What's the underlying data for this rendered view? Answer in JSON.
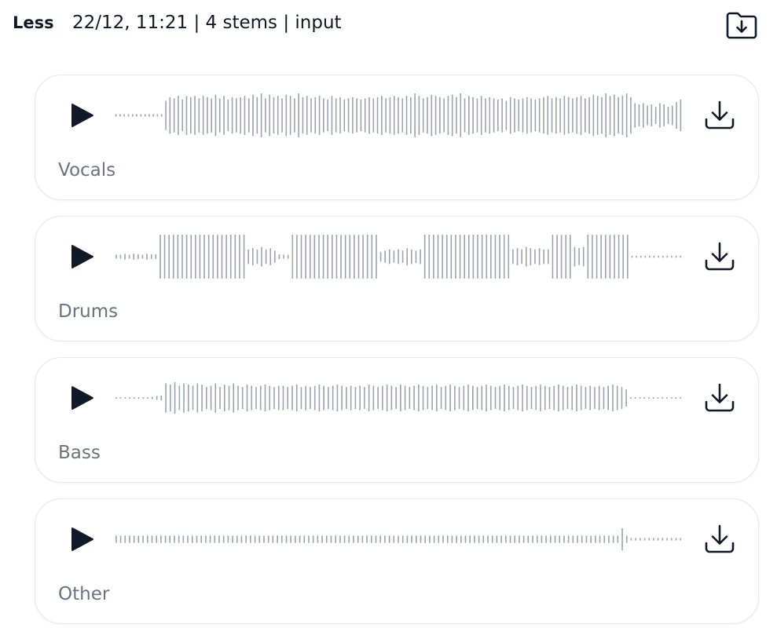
{
  "header": {
    "toggle_label": "Less",
    "meta": "22/12, 11:21 | 4 stems | input",
    "folder_icon": "folder-download-icon"
  },
  "colors": {
    "text": "#111827",
    "label": "#6b7280",
    "waveform": "#9ca3af",
    "card_border": "#e5e7eb"
  },
  "stems": [
    {
      "label": "Vocals",
      "play_icon": "play-icon",
      "download_icon": "download-icon",
      "waveform_levels": [
        0.05,
        0.05,
        0.05,
        0.05,
        0.05,
        0.05,
        0.05,
        0.05,
        0.05,
        0.05,
        0.05,
        0.05,
        0.6,
        0.75,
        0.7,
        0.8,
        0.65,
        0.8,
        0.75,
        0.8,
        0.7,
        0.8,
        0.75,
        0.7,
        0.85,
        0.7,
        0.8,
        0.65,
        0.75,
        0.7,
        0.75,
        0.8,
        0.7,
        0.85,
        0.75,
        0.9,
        0.7,
        0.85,
        0.75,
        0.8,
        0.7,
        0.85,
        0.8,
        0.7,
        0.9,
        0.75,
        0.8,
        0.7,
        0.75,
        0.8,
        0.7,
        0.65,
        0.8,
        0.7,
        0.75,
        0.65,
        0.7,
        0.75,
        0.7,
        0.65,
        0.7,
        0.75,
        0.7,
        0.75,
        0.8,
        0.7,
        0.75,
        0.8,
        0.75,
        0.7,
        0.8,
        0.75,
        0.9,
        0.8,
        0.7,
        0.75,
        0.85,
        0.8,
        0.75,
        0.7,
        0.8,
        0.85,
        0.75,
        0.9,
        0.7,
        0.8,
        0.75,
        0.7,
        0.8,
        0.7,
        0.75,
        0.7,
        0.65,
        0.7,
        0.6,
        0.75,
        0.7,
        0.65,
        0.7,
        0.75,
        0.7,
        0.65,
        0.7,
        0.75,
        0.8,
        0.7,
        0.75,
        0.7,
        0.8,
        0.75,
        0.7,
        0.75,
        0.8,
        0.7,
        0.75,
        0.85,
        0.8,
        0.75,
        0.9,
        0.8,
        0.85,
        0.75,
        0.8,
        0.9,
        0.75,
        0.5,
        0.45,
        0.5,
        0.4,
        0.45,
        0.35,
        0.5,
        0.45,
        0.35,
        0.4,
        0.55,
        0.65
      ]
    },
    {
      "label": "Drums",
      "play_icon": "play-icon",
      "download_icon": "download-icon",
      "waveform_levels": [
        0.08,
        0.08,
        0.12,
        0.08,
        0.12,
        0.1,
        0.08,
        0.12,
        0.1,
        0.1,
        0.9,
        0.9,
        0.9,
        0.9,
        0.9,
        0.9,
        0.9,
        0.9,
        0.9,
        0.9,
        0.9,
        0.9,
        0.9,
        0.9,
        0.9,
        0.9,
        0.9,
        0.9,
        0.9,
        0.9,
        0.3,
        0.35,
        0.3,
        0.4,
        0.3,
        0.35,
        0.25,
        0.1,
        0.08,
        0.08,
        0.9,
        0.9,
        0.9,
        0.9,
        0.9,
        0.9,
        0.9,
        0.9,
        0.9,
        0.9,
        0.9,
        0.9,
        0.9,
        0.9,
        0.9,
        0.9,
        0.9,
        0.9,
        0.9,
        0.9,
        0.2,
        0.25,
        0.3,
        0.25,
        0.3,
        0.25,
        0.35,
        0.3,
        0.25,
        0.3,
        0.9,
        0.9,
        0.9,
        0.9,
        0.9,
        0.9,
        0.9,
        0.9,
        0.9,
        0.9,
        0.9,
        0.9,
        0.9,
        0.9,
        0.9,
        0.9,
        0.9,
        0.9,
        0.9,
        0.9,
        0.3,
        0.35,
        0.3,
        0.4,
        0.35,
        0.3,
        0.35,
        0.3,
        0.3,
        0.9,
        0.9,
        0.9,
        0.9,
        0.9,
        0.4,
        0.35,
        0.4,
        0.9,
        0.9,
        0.9,
        0.9,
        0.9,
        0.9,
        0.9,
        0.9,
        0.9,
        0.9,
        0.04,
        0.04,
        0.04,
        0.04,
        0.04,
        0.04,
        0.04,
        0.04,
        0.04,
        0.04,
        0.04,
        0.04
      ]
    },
    {
      "label": "Bass",
      "play_icon": "play-icon",
      "download_icon": "download-icon",
      "waveform_levels": [
        0.03,
        0.03,
        0.03,
        0.03,
        0.03,
        0.03,
        0.03,
        0.03,
        0.05,
        0.08,
        0.1,
        0.6,
        0.55,
        0.65,
        0.5,
        0.6,
        0.55,
        0.5,
        0.6,
        0.55,
        0.45,
        0.5,
        0.6,
        0.45,
        0.55,
        0.5,
        0.6,
        0.5,
        0.45,
        0.55,
        0.5,
        0.45,
        0.5,
        0.55,
        0.5,
        0.45,
        0.5,
        0.5,
        0.45,
        0.5,
        0.55,
        0.45,
        0.5,
        0.45,
        0.5,
        0.55,
        0.5,
        0.45,
        0.5,
        0.55,
        0.5,
        0.45,
        0.5,
        0.45,
        0.5,
        0.45,
        0.55,
        0.5,
        0.45,
        0.5,
        0.55,
        0.5,
        0.45,
        0.55,
        0.5,
        0.45,
        0.5,
        0.55,
        0.5,
        0.45,
        0.5,
        0.55,
        0.45,
        0.5,
        0.55,
        0.5,
        0.45,
        0.5,
        0.55,
        0.5,
        0.45,
        0.5,
        0.55,
        0.5,
        0.45,
        0.5,
        0.55,
        0.5,
        0.45,
        0.5,
        0.55,
        0.5,
        0.45,
        0.5,
        0.55,
        0.5,
        0.45,
        0.5,
        0.55,
        0.5,
        0.45,
        0.5,
        0.55,
        0.5,
        0.45,
        0.5,
        0.45,
        0.5,
        0.45,
        0.5,
        0.55,
        0.5,
        0.45,
        0.35,
        0.03,
        0.03,
        0.03,
        0.03,
        0.03,
        0.03,
        0.03,
        0.03,
        0.03,
        0.03,
        0.03,
        0.03
      ]
    },
    {
      "label": "Other",
      "play_icon": "play-icon",
      "download_icon": "download-icon",
      "waveform_levels": [
        0.15,
        0.15,
        0.15,
        0.15,
        0.15,
        0.15,
        0.15,
        0.15,
        0.15,
        0.15,
        0.15,
        0.15,
        0.15,
        0.15,
        0.15,
        0.15,
        0.15,
        0.15,
        0.15,
        0.15,
        0.15,
        0.15,
        0.15,
        0.15,
        0.15,
        0.15,
        0.15,
        0.15,
        0.15,
        0.15,
        0.15,
        0.15,
        0.15,
        0.15,
        0.15,
        0.15,
        0.15,
        0.15,
        0.15,
        0.15,
        0.15,
        0.15,
        0.15,
        0.15,
        0.15,
        0.15,
        0.15,
        0.15,
        0.15,
        0.15,
        0.15,
        0.15,
        0.15,
        0.15,
        0.15,
        0.15,
        0.15,
        0.15,
        0.15,
        0.15,
        0.15,
        0.15,
        0.15,
        0.15,
        0.15,
        0.15,
        0.15,
        0.15,
        0.15,
        0.15,
        0.15,
        0.15,
        0.15,
        0.15,
        0.15,
        0.15,
        0.15,
        0.15,
        0.15,
        0.15,
        0.15,
        0.15,
        0.15,
        0.15,
        0.15,
        0.15,
        0.15,
        0.15,
        0.15,
        0.15,
        0.15,
        0.15,
        0.15,
        0.15,
        0.15,
        0.15,
        0.15,
        0.15,
        0.15,
        0.15,
        0.15,
        0.15,
        0.15,
        0.15,
        0.15,
        0.15,
        0.15,
        0.15,
        0.15,
        0.15,
        0.15,
        0.15,
        0.15,
        0.45,
        0.15,
        0.05,
        0.05,
        0.05,
        0.05,
        0.05,
        0.05,
        0.05,
        0.05,
        0.05,
        0.05,
        0.05,
        0.05
      ]
    }
  ]
}
